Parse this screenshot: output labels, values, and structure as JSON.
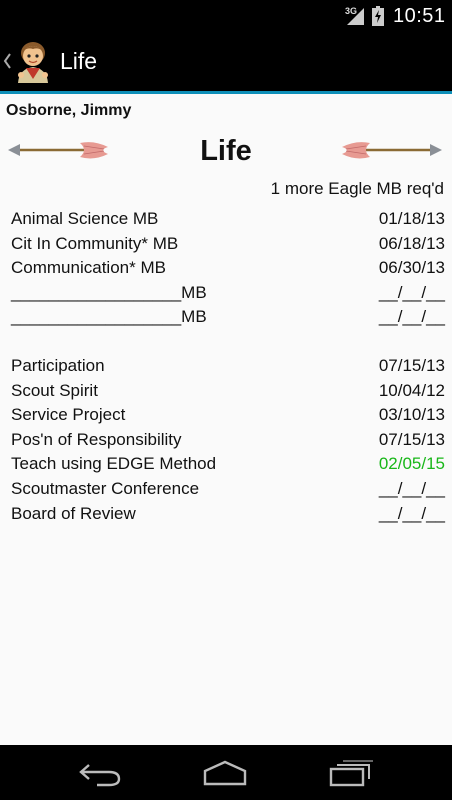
{
  "status_bar": {
    "network_type": "3G",
    "time": "10:51",
    "icons": [
      "signal-icon",
      "battery-icon"
    ]
  },
  "action_bar": {
    "title": "Life",
    "icons": [
      "back-chevron-icon",
      "scout-logo-icon"
    ]
  },
  "scout": {
    "name": "Osborne, Jimmy"
  },
  "rank": {
    "title": "Life",
    "note": "1 more Eagle MB req'd"
  },
  "merit_badges": [
    {
      "label": "Animal Science MB",
      "date": "01/18/13"
    },
    {
      "label": "Cit In Community* MB",
      "date": "06/18/13"
    },
    {
      "label": "Communication* MB",
      "date": "06/30/13"
    },
    {
      "label": "__________________MB",
      "date": "__/__/__"
    },
    {
      "label": "__________________MB",
      "date": "__/__/__"
    }
  ],
  "requirements": [
    {
      "label": "Participation",
      "date": "07/15/13"
    },
    {
      "label": "Scout Spirit",
      "date": "10/04/12"
    },
    {
      "label": "Service Project",
      "date": "03/10/13"
    },
    {
      "label": "Pos'n of Responsibility",
      "date": "07/15/13"
    },
    {
      "label": "Teach using EDGE Method",
      "date": "02/05/15",
      "highlight_color": "#19b719"
    },
    {
      "label": "Scoutmaster Conference",
      "date": "__/__/__"
    },
    {
      "label": "Board of Review",
      "date": "__/__/__"
    }
  ],
  "nav_bar": {
    "icons": [
      "back-icon",
      "home-icon",
      "recents-icon"
    ]
  },
  "colors": {
    "accent_line": "#0e8fb8",
    "highlight_date": "#19b719",
    "background": "#fafafa"
  }
}
